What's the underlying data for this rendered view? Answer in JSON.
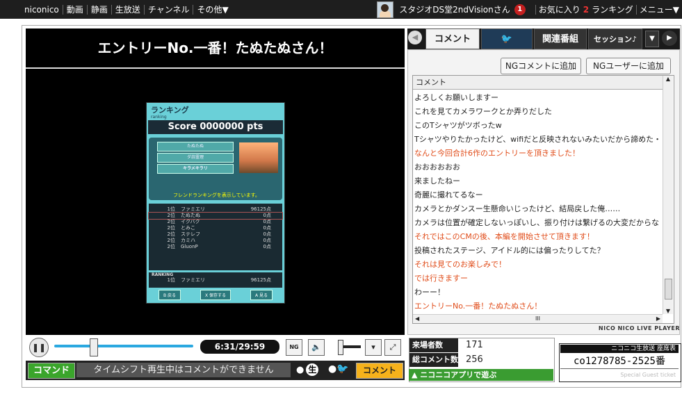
{
  "topnav": {
    "items": [
      "niconico",
      "動画",
      "静画",
      "生放送",
      "チャンネル",
      "その他▼"
    ],
    "user": "スタジオDS堂2ndVisionさん",
    "notif_count": "1",
    "favorites": "お気に入り",
    "favorites_count": "2",
    "ranking": "ランキング",
    "menu": "メニュー▼"
  },
  "player": {
    "title": "エントリーNo.一番！たぬたぬさん！",
    "time": "6:31/29:59",
    "seek_progress": 0.22,
    "command_label": "コマンド",
    "comment_input_placeholder": "タイムシフト再生中はコメントができません",
    "live_label": "生",
    "comment_button": "コメント"
  },
  "game": {
    "header": "ランキング",
    "header_sub": "ranking",
    "score": "Score 0000000 pts",
    "buttons": [
      "たぬたぬ",
      "ダ蒜霊理",
      "キラメキラリ"
    ],
    "message": "フレンドランキングを表示しています。",
    "rows": [
      {
        "rank": "1位",
        "name": "ファミエリ",
        "score": "96125点"
      },
      {
        "rank": "2位",
        "name": "たぬたぬ",
        "score": "0点"
      },
      {
        "rank": "2位",
        "name": "イクバク",
        "score": "0点"
      },
      {
        "rank": "2位",
        "name": "とみこ",
        "score": "0点"
      },
      {
        "rank": "2位",
        "name": "ステレフ",
        "score": "0点"
      },
      {
        "rank": "2位",
        "name": "カミハ",
        "score": "0点"
      },
      {
        "rank": "2位",
        "name": "GluonP",
        "score": "0点"
      }
    ],
    "ranking_label": "RANKING",
    "ranking_row": {
      "rank": "1位",
      "name": "ファミエリ",
      "score": "96125点"
    },
    "footer": [
      "B 戻る",
      "X 保存する",
      "A 見る"
    ]
  },
  "tabs": {
    "comment": "コメント",
    "twitter": "twitter",
    "related": "関連番組",
    "session": "セッション♪"
  },
  "comments": {
    "ng_comment_button": "NGコメントに追加",
    "ng_user_button": "NGユーザーに追加",
    "column_header": "コメント",
    "rows": [
      {
        "text": "よろしくお願いしますー",
        "op": false
      },
      {
        "text": "これを見てカメラワークとか弄りだした",
        "op": false
      },
      {
        "text": "このTシャツがツボったw",
        "op": false
      },
      {
        "text": "Tシャツやりたかったけど、wifiだと反映されないみたいだから諦めた・・",
        "op": false
      },
      {
        "text": "なんと今回合計6作のエントリーを頂きました！",
        "op": true
      },
      {
        "text": "おおおおおお",
        "op": false
      },
      {
        "text": "来ましたねー",
        "op": false
      },
      {
        "text": "奇麗に撮れてるなー",
        "op": false
      },
      {
        "text": "カメラとかダンスー生懸命いじったけど、結局戻した俺……",
        "op": false
      },
      {
        "text": "カメラは位置が確定しないっぽいし、振り付けは繋げるの大変だからな",
        "op": false
      },
      {
        "text": "それではこのCMの後、本編を開始させて頂きます！",
        "op": true
      },
      {
        "text": "投稿されたステージ、アイドル的には偏ったりしてた？",
        "op": false
      },
      {
        "text": "それは見てのお楽しみで！",
        "op": true
      },
      {
        "text": "では行きますー",
        "op": true
      },
      {
        "text": "わーー！",
        "op": false
      },
      {
        "text": "エントリーNo.一番！たぬたぬさん！",
        "op": true
      }
    ],
    "scroll_label": "III",
    "player_brand": "NICO NICO LIVE PLAYER"
  },
  "stats": {
    "visitors_label": "来場者数",
    "visitors": "171",
    "comments_label": "総コメント数",
    "comments": "256",
    "app_label": "▲ ニコニコアプリで遊ぶ"
  },
  "ticket": {
    "header": "ニコニコ生放送 座席表",
    "id": "co1278785-2525番",
    "sub": "Special Guest ticket"
  },
  "colors": {
    "op_comment": "#e04b18",
    "command_green": "#3aa52b",
    "comment_yellow": "#f6b21b",
    "seek_blue": "#2aa8e0"
  }
}
